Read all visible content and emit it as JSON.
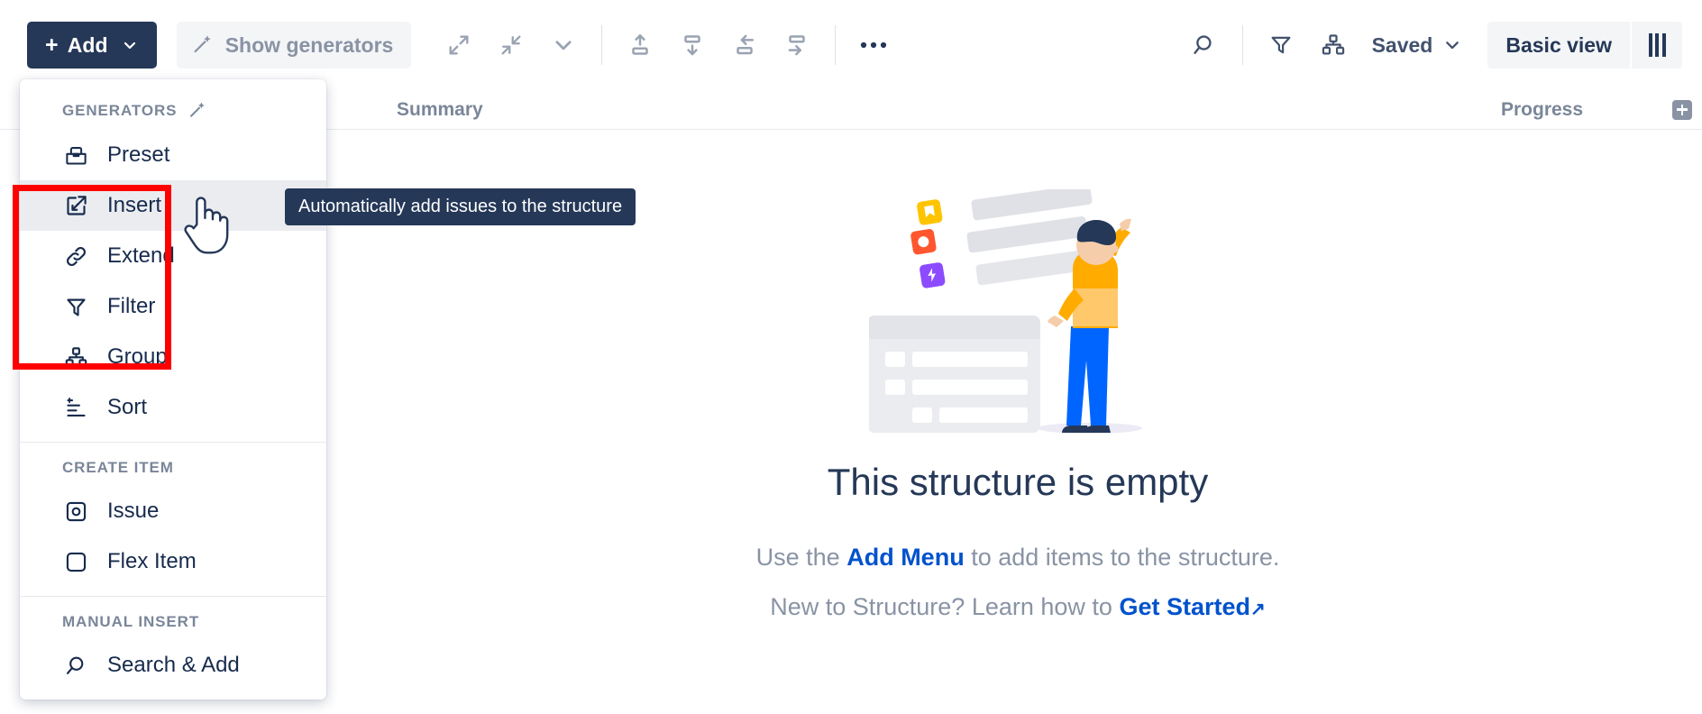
{
  "toolbar": {
    "add_label": "Add",
    "add_plus": "+",
    "show_generators_label": "Show generators",
    "expand_all_icon": "expand-arrows-icon",
    "collapse_all_icon": "collapse-arrows-icon",
    "chevron_icon": "chevron-down-icon",
    "move_up_label": "move-up-icon",
    "move_down_label": "move-down-icon",
    "move_left_label": "move-left-icon",
    "move_right_label": "move-right-icon",
    "more_label": "•••",
    "search_icon": "search-icon",
    "filter_icon": "filter-icon",
    "group_icon": "group-icon",
    "saved_label": "Saved",
    "basic_view_label": "Basic view",
    "columns_icon": "columns-icon"
  },
  "columns": {
    "summary": "Summary",
    "progress": "Progress",
    "add_column": "add-column-icon"
  },
  "menu": {
    "sections": [
      {
        "label": "GENERATORS",
        "pin_icon": "magic-wand-icon",
        "items": [
          {
            "label": "Preset",
            "icon": "preset-box-icon",
            "active": false
          },
          {
            "label": "Insert",
            "icon": "insert-icon",
            "active": true
          },
          {
            "label": "Extend",
            "icon": "link-icon",
            "active": false
          },
          {
            "label": "Filter",
            "icon": "filter-icon",
            "active": false
          },
          {
            "label": "Group",
            "icon": "group-icon",
            "active": false
          },
          {
            "label": "Sort",
            "icon": "sort-icon",
            "active": false
          }
        ]
      },
      {
        "label": "CREATE ITEM",
        "items": [
          {
            "label": "Issue",
            "icon": "issue-icon",
            "active": false
          },
          {
            "label": "Flex Item",
            "icon": "square-icon",
            "active": false
          }
        ]
      },
      {
        "label": "MANUAL INSERT",
        "items": [
          {
            "label": "Search & Add",
            "icon": "search-icon",
            "active": false
          }
        ]
      }
    ]
  },
  "tooltip": {
    "text": "Automatically add issues to the structure"
  },
  "empty_state": {
    "title": "This structure is empty",
    "line1_prefix": "Use the ",
    "line1_link": "Add Menu",
    "line1_suffix": " to add items to the structure.",
    "line2_prefix": "New to Structure? Learn how to ",
    "line2_link": "Get Started",
    "line2_arrow": "↗"
  },
  "colors": {
    "primary_dark": "#253858",
    "accent_blue": "#0052cc",
    "highlight_red": "#ff0000",
    "muted_text": "#8993a4",
    "active_row": "#ebecf0"
  }
}
